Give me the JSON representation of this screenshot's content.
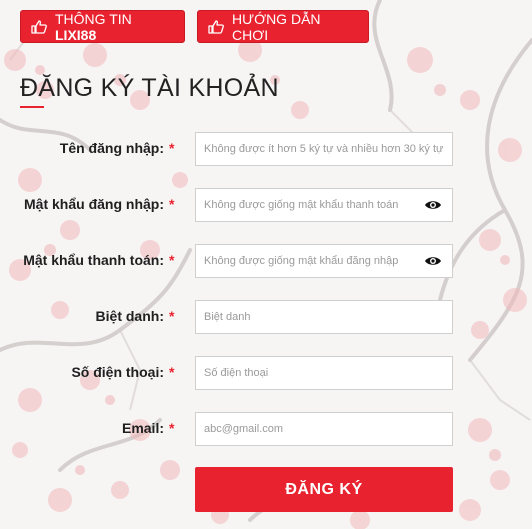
{
  "header": {
    "info_button": {
      "label": "THÔNG TIN ",
      "brand": "LIXI88",
      "icon": "pointing-hand-icon"
    },
    "guide_button": {
      "label": "HƯỚNG DẪN CHƠI",
      "icon": "pointing-hand-icon"
    }
  },
  "form": {
    "title": "ĐĂNG KÝ TÀI KHOẢN",
    "required_mark": "*",
    "fields": [
      {
        "label": "Tên đăng nhập:",
        "placeholder": "Không được ít hơn 5 ký tự và nhiều hơn 30 ký tự",
        "type": "text"
      },
      {
        "label": "Mật khẩu đăng nhập:",
        "placeholder": "Không được giống mật khẩu thanh toán",
        "type": "password",
        "icon": "eye-icon"
      },
      {
        "label": "Mật khẩu thanh toán:",
        "placeholder": "Không được giống mật khẩu đăng nhập",
        "type": "password",
        "icon": "eye-icon"
      },
      {
        "label": "Biệt danh:",
        "placeholder": "Biệt danh",
        "type": "text"
      },
      {
        "label": "Số điện thoại:",
        "placeholder": "Số điện thoại",
        "type": "text"
      },
      {
        "label": "Email:",
        "placeholder": "abc@gmail.com",
        "type": "email"
      }
    ],
    "submit_label": "ĐĂNG KÝ"
  },
  "colors": {
    "accent": "#e8232f",
    "text": "#1f1f1f",
    "border": "#cfcfcf"
  }
}
